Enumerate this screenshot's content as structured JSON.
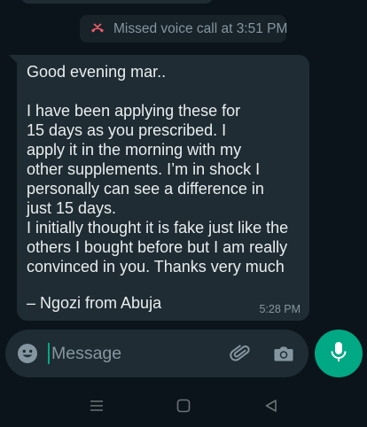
{
  "system_message": {
    "text": "Missed voice call at 3:51 PM"
  },
  "message": {
    "lines": [
      "Good evening mar..",
      "",
      "I have been applying these for",
      "15 days as you prescribed. I",
      "apply it in the morning with my",
      "other supplements. I’m in shock I",
      "personally can see a difference in",
      "just 15 days.",
      "I initially thought it is fake just like the",
      "others I bought before but I am really",
      "convinced in you. Thanks very much",
      "",
      "– Ngozi from Abuja"
    ],
    "time": "5:28 PM"
  },
  "composer": {
    "placeholder": "Message"
  },
  "colors": {
    "accent": "#00a884",
    "missed_call": "#ea5e6b",
    "bubble": "#1f2c33",
    "background": "#0b141a"
  },
  "icons": [
    "missed-call-icon",
    "emoji-icon",
    "attach-icon",
    "camera-icon",
    "mic-icon",
    "recent-apps-icon",
    "home-icon",
    "back-icon"
  ]
}
